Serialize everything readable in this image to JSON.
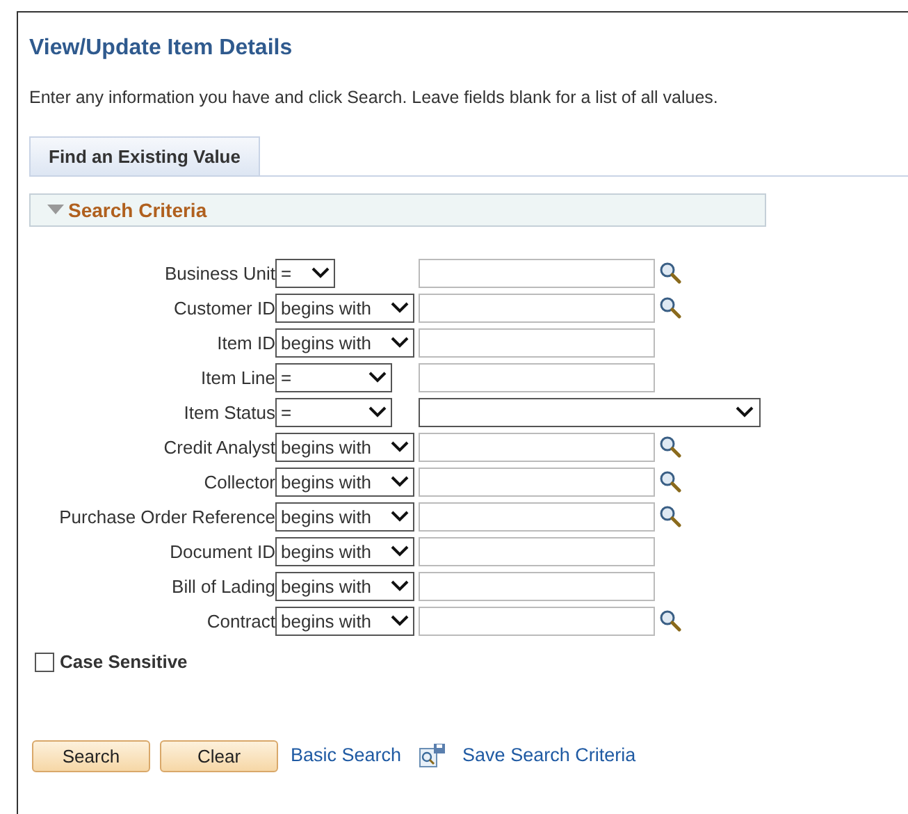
{
  "title": "View/Update Item Details",
  "instructions": "Enter any information you have and click Search. Leave fields blank for a list of all values.",
  "tabs": [
    {
      "label": "Find an Existing Value",
      "selected": true
    }
  ],
  "section": {
    "title": "Search Criteria",
    "expanded": true
  },
  "criteria": [
    {
      "label": "Business Unit",
      "operator": {
        "value": "=",
        "kind": "narrow"
      },
      "field": {
        "kind": "text",
        "lookup": true
      }
    },
    {
      "label": "Customer ID",
      "operator": {
        "value": "begins with",
        "kind": "wide"
      },
      "field": {
        "kind": "text",
        "lookup": true
      }
    },
    {
      "label": "Item ID",
      "operator": {
        "value": "begins with",
        "kind": "wide"
      },
      "field": {
        "kind": "text",
        "lookup": false
      }
    },
    {
      "label": "Item Line",
      "operator": {
        "value": "=",
        "kind": "medium"
      },
      "field": {
        "kind": "text",
        "lookup": false
      }
    },
    {
      "label": "Item Status",
      "operator": {
        "value": "=",
        "kind": "medium"
      },
      "field": {
        "kind": "dropdown",
        "lookup": false
      }
    },
    {
      "label": "Credit Analyst",
      "operator": {
        "value": "begins with",
        "kind": "wide"
      },
      "field": {
        "kind": "text",
        "lookup": true
      }
    },
    {
      "label": "Collector",
      "operator": {
        "value": "begins with",
        "kind": "wide"
      },
      "field": {
        "kind": "text",
        "lookup": true
      }
    },
    {
      "label": "Purchase Order Reference",
      "operator": {
        "value": "begins with",
        "kind": "wide"
      },
      "field": {
        "kind": "text",
        "lookup": true
      }
    },
    {
      "label": "Document ID",
      "operator": {
        "value": "begins with",
        "kind": "wide"
      },
      "field": {
        "kind": "text",
        "lookup": false
      }
    },
    {
      "label": "Bill of Lading",
      "operator": {
        "value": "begins with",
        "kind": "wide"
      },
      "field": {
        "kind": "text",
        "lookup": false
      }
    },
    {
      "label": "Contract",
      "operator": {
        "value": "begins with",
        "kind": "wide"
      },
      "field": {
        "kind": "text",
        "lookup": true
      }
    }
  ],
  "case_sensitive": {
    "label": "Case Sensitive",
    "checked": false
  },
  "buttons": [
    "Search",
    "Clear"
  ],
  "links": [
    {
      "label": "Basic Search",
      "icon": false
    },
    {
      "label": "Save Search Criteria",
      "icon": true
    }
  ]
}
